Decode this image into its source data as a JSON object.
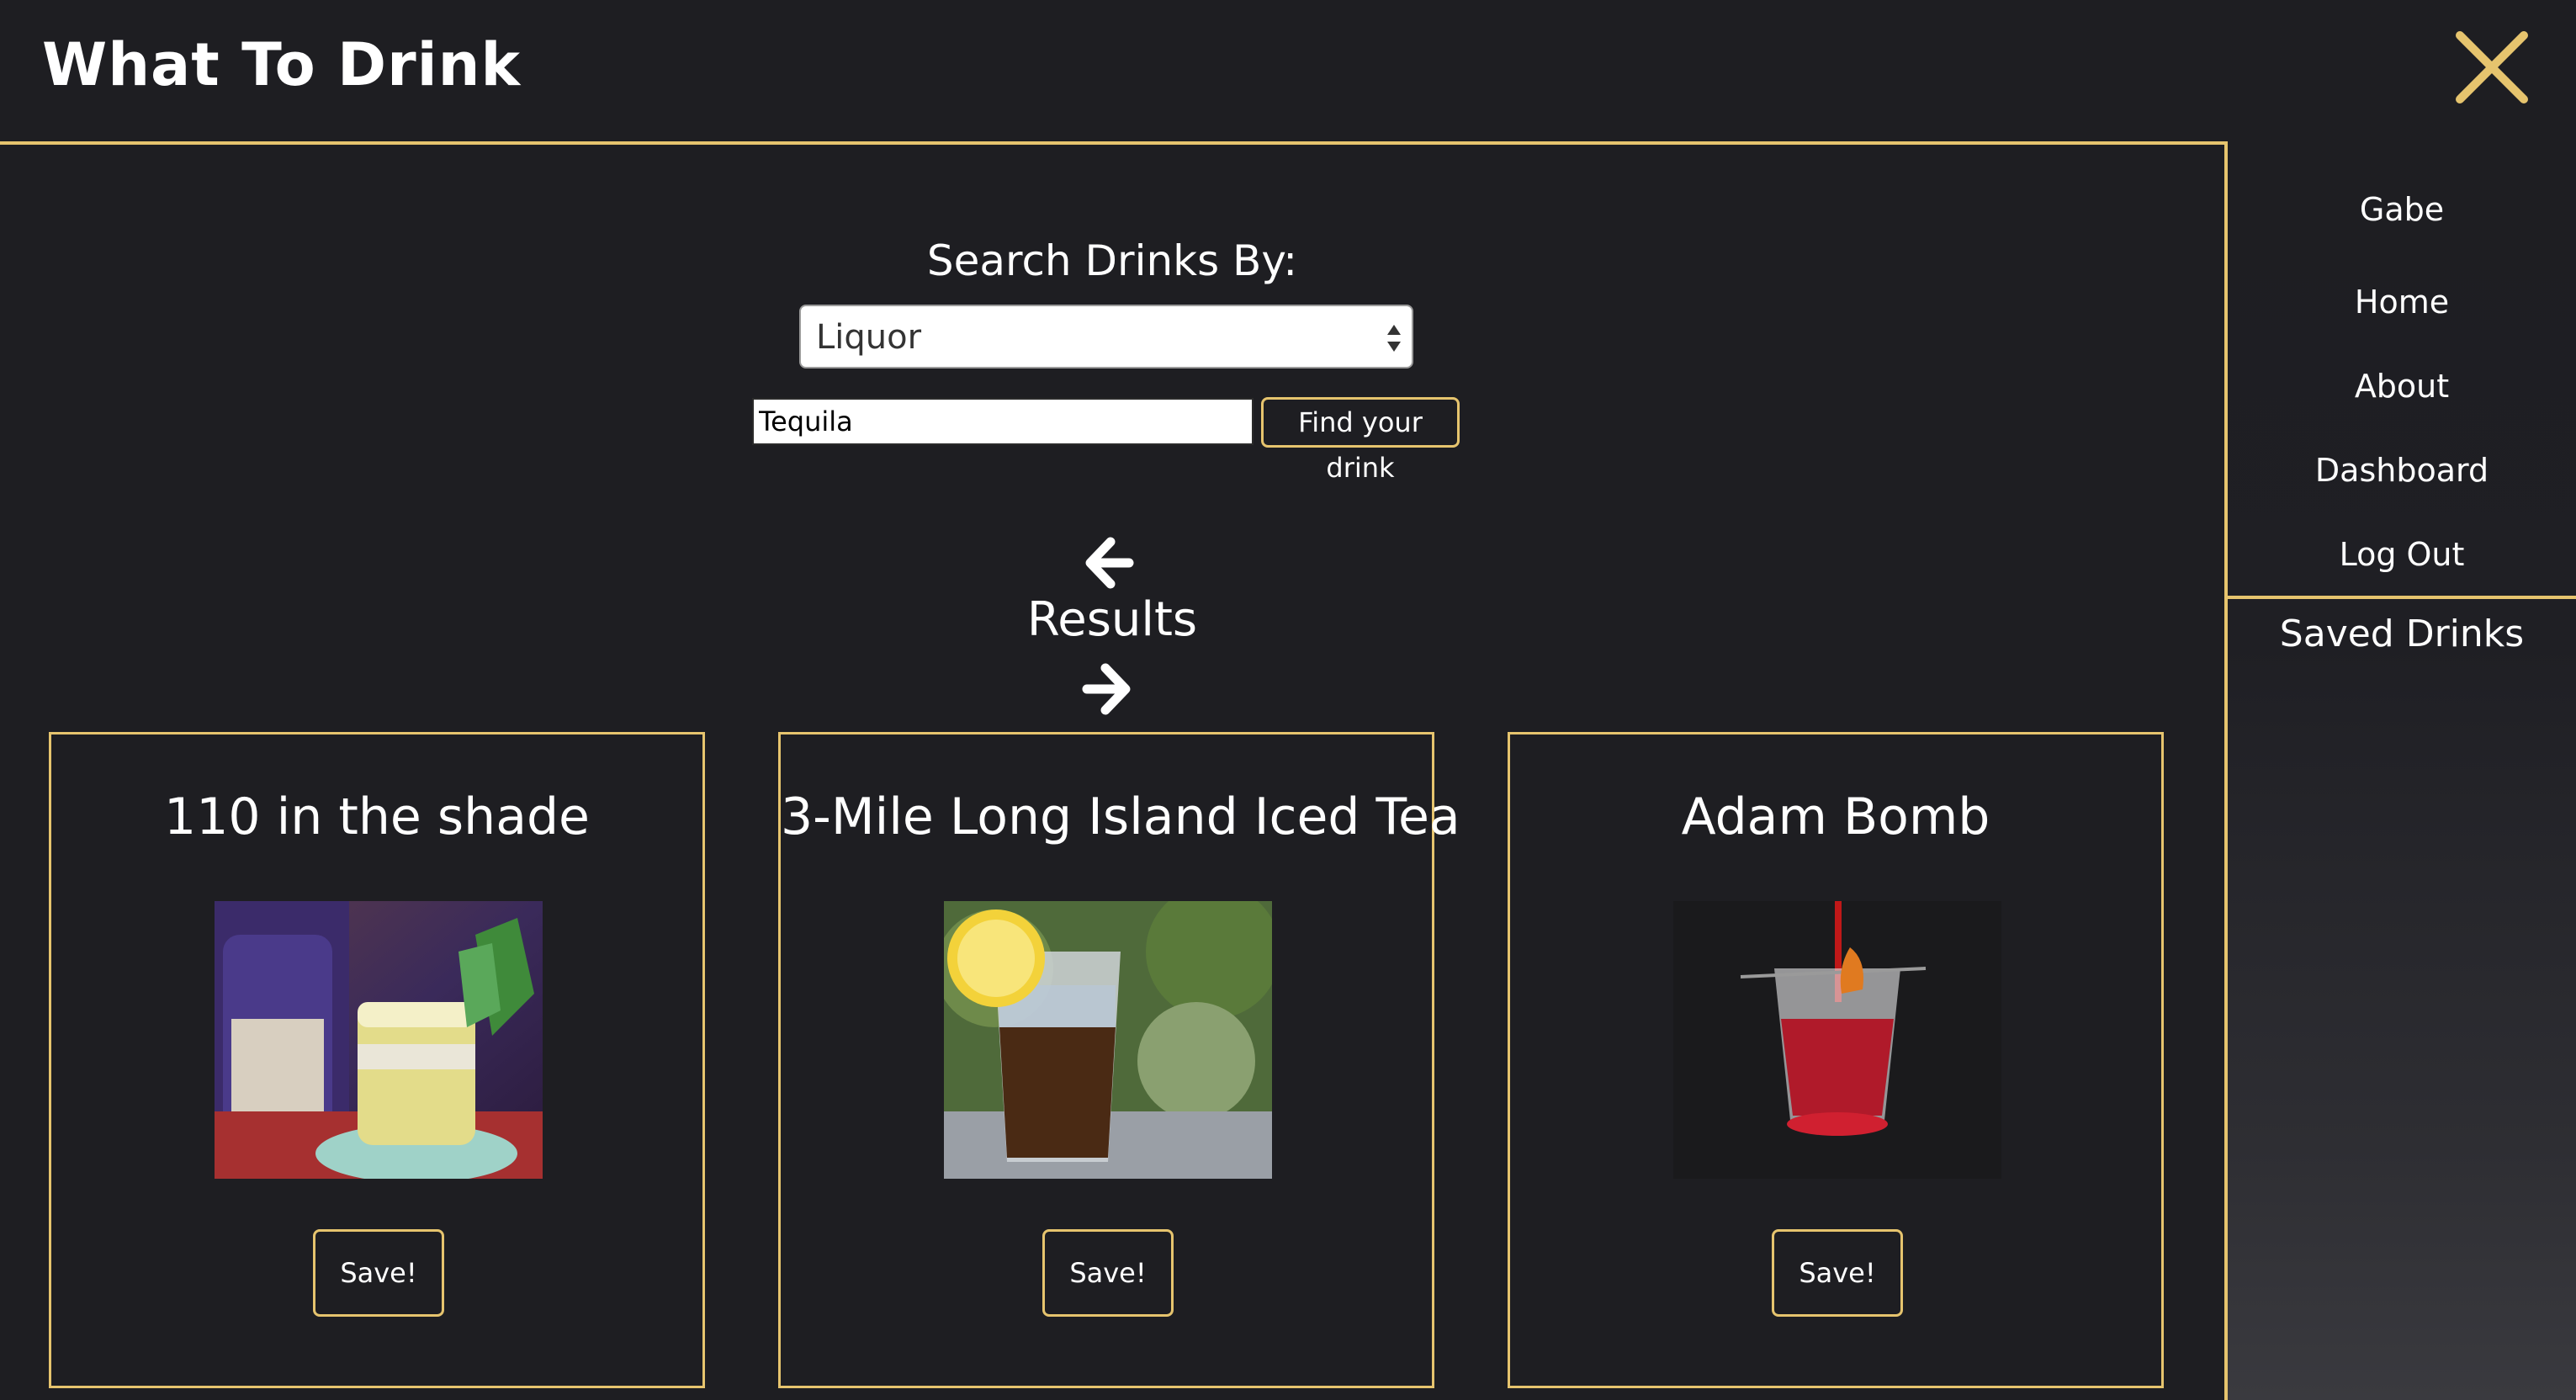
{
  "header": {
    "title": "What To Drink",
    "close_icon": "close-x-icon"
  },
  "colors": {
    "background": "#1e1e22",
    "accent": "#e6c46e",
    "text": "#ffffff"
  },
  "search": {
    "heading": "Search Drinks By:",
    "select_value": "Liquor",
    "input_value": "Tequila",
    "button_label": "Find your drink"
  },
  "results": {
    "heading": "Results",
    "prev_icon": "arrow-left-icon",
    "next_icon": "arrow-right-icon",
    "cards": [
      {
        "title": "110 in the shade",
        "save_label": "Save!"
      },
      {
        "title": "3-Mile Long Island Iced Tea",
        "save_label": "Save!"
      },
      {
        "title": "Adam Bomb",
        "save_label": "Save!"
      }
    ]
  },
  "sidebar": {
    "user": "Gabe",
    "items": [
      "Home",
      "About",
      "Dashboard",
      "Log Out"
    ],
    "saved_heading": "Saved Drinks"
  }
}
